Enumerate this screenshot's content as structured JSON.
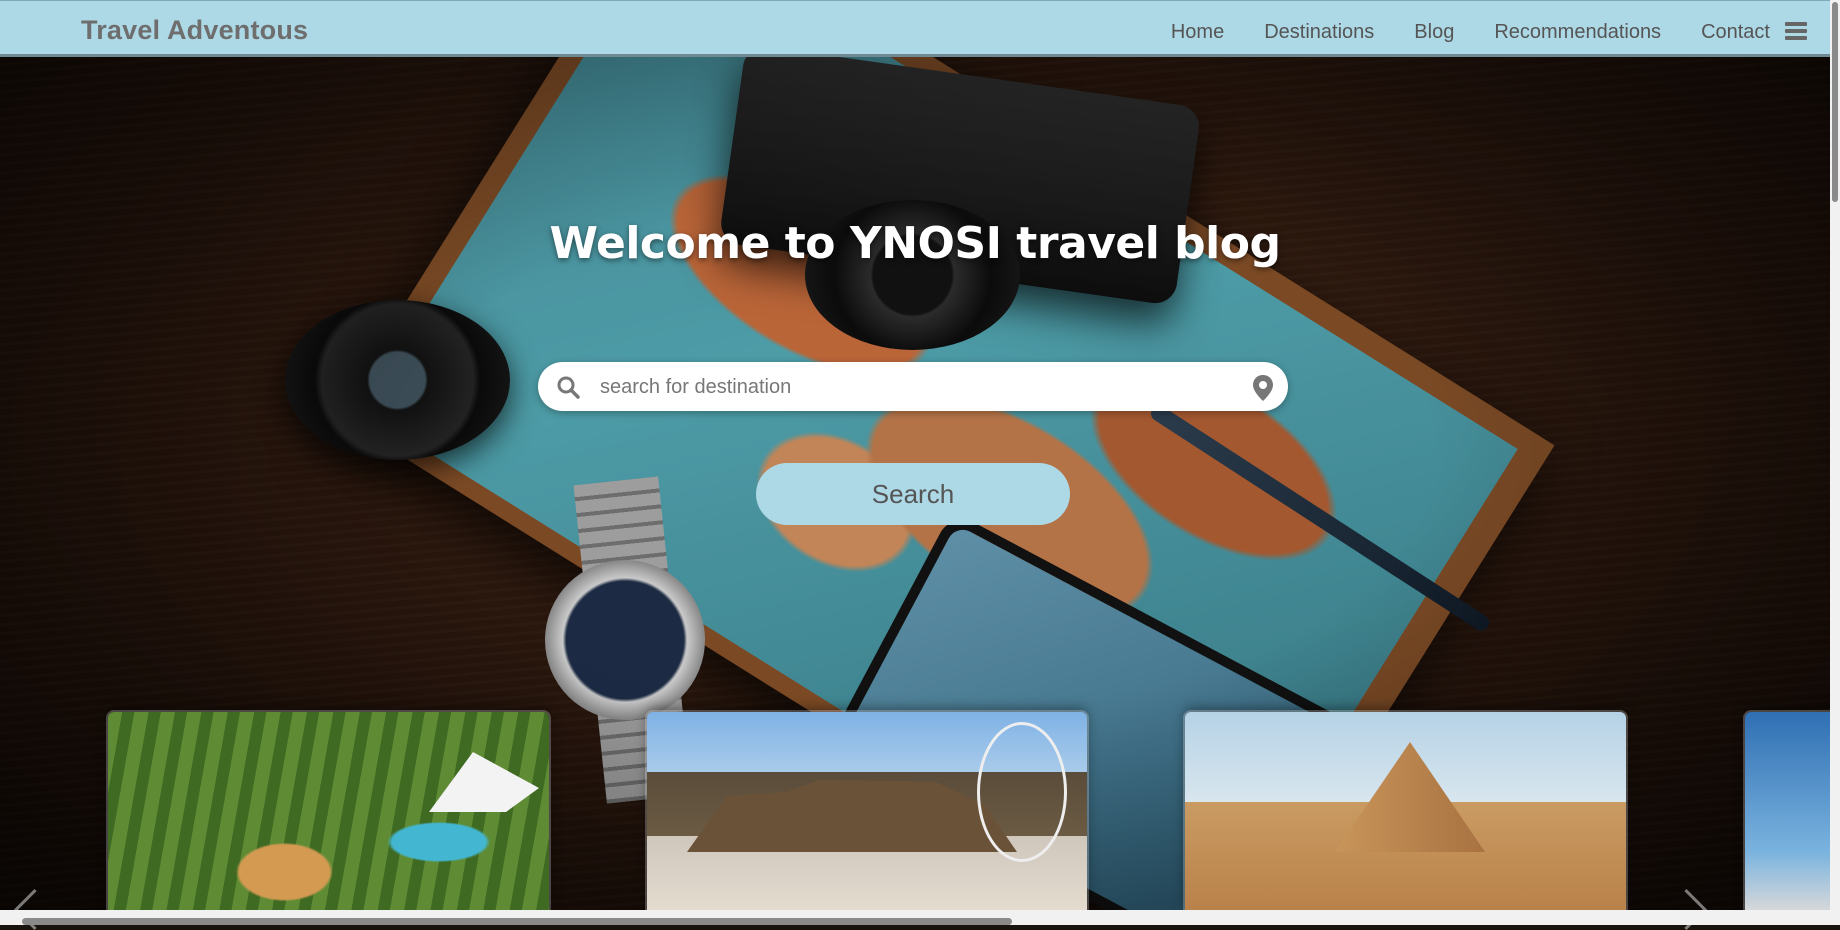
{
  "app": {
    "brand": "Travel Adventous"
  },
  "nav": {
    "items": [
      "Home",
      "Destinations",
      "Blog",
      "Recommendations",
      "Contact"
    ],
    "menu_icon": "hamburger-icon"
  },
  "hero": {
    "title": "Welcome to YNOSI travel blog",
    "search": {
      "placeholder": "search for destination",
      "value": "",
      "leading_icon": "search-icon",
      "trailing_icon": "location-pin-icon"
    },
    "search_button_label": "Search"
  },
  "carousel": {
    "cards": [
      {
        "subject": "waterpark-resort"
      },
      {
        "subject": "table-mountain-city"
      },
      {
        "subject": "pyramid-desert"
      },
      {
        "subject": "sky-partial"
      }
    ],
    "prev_icon": "chevron-left-icon",
    "next_icon": "chevron-right-icon"
  },
  "colors": {
    "navbar_bg": "#add8e6",
    "button_bg": "#add8e6",
    "brand_text": "#6e6e6e",
    "nav_text": "#555555",
    "title_text": "#ffffff"
  }
}
